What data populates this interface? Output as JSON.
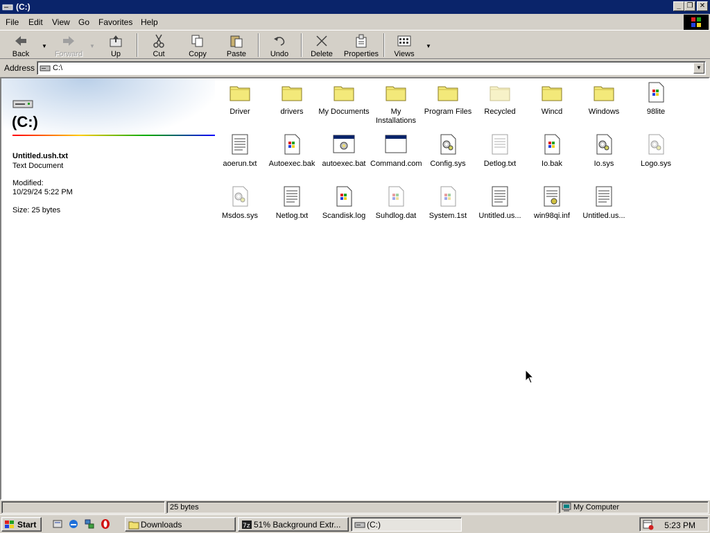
{
  "window": {
    "title": "(C:)"
  },
  "menu": {
    "file": "File",
    "edit": "Edit",
    "view": "View",
    "go": "Go",
    "favorites": "Favorites",
    "help": "Help"
  },
  "toolbar": {
    "back": "Back",
    "forward": "Forward",
    "up": "Up",
    "cut": "Cut",
    "copy": "Copy",
    "paste": "Paste",
    "undo": "Undo",
    "delete": "Delete",
    "properties": "Properties",
    "views": "Views"
  },
  "address": {
    "label": "Address",
    "value": "C:\\"
  },
  "left_pane": {
    "title": "(C:)",
    "selected_name": "Untitled.ush.txt",
    "selected_type": "Text Document",
    "modified_label": "Modified:",
    "modified_date": "10/29/24 5:22 PM",
    "size": "Size: 25 bytes"
  },
  "files": [
    {
      "name": "Driver",
      "icon": "folder-icon"
    },
    {
      "name": "drivers",
      "icon": "folder-icon"
    },
    {
      "name": "My Documents",
      "icon": "folder-icon"
    },
    {
      "name": "My Installations",
      "icon": "folder-icon"
    },
    {
      "name": "Program Files",
      "icon": "folder-icon"
    },
    {
      "name": "Recycled",
      "icon": "folder-hidden-icon"
    },
    {
      "name": "Wincd",
      "icon": "folder-icon"
    },
    {
      "name": "Windows",
      "icon": "folder-icon"
    },
    {
      "name": "98lite",
      "icon": "windows-file-icon"
    },
    {
      "name": "aoerun.txt",
      "icon": "text-file-icon"
    },
    {
      "name": "Autoexec.bak",
      "icon": "windows-file-icon"
    },
    {
      "name": "autoexec.bat",
      "icon": "batch-file-icon"
    },
    {
      "name": "Command.com",
      "icon": "dos-app-icon"
    },
    {
      "name": "Config.sys",
      "icon": "system-file-icon"
    },
    {
      "name": "Detlog.txt",
      "icon": "text-file-hidden-icon"
    },
    {
      "name": "Io.bak",
      "icon": "windows-file-icon"
    },
    {
      "name": "Io.sys",
      "icon": "system-file-icon"
    },
    {
      "name": "Logo.sys",
      "icon": "system-file-hidden-icon"
    },
    {
      "name": "Msdos.sys",
      "icon": "system-file-hidden-icon"
    },
    {
      "name": "Netlog.txt",
      "icon": "text-file-icon"
    },
    {
      "name": "Scandisk.log",
      "icon": "windows-file-icon"
    },
    {
      "name": "Suhdlog.dat",
      "icon": "windows-file-hidden-icon"
    },
    {
      "name": "System.1st",
      "icon": "windows-file-hidden-icon"
    },
    {
      "name": "Untitled.us...",
      "icon": "text-file-icon"
    },
    {
      "name": "win98qi.inf",
      "icon": "setup-info-icon"
    },
    {
      "name": "Untitled.us...",
      "icon": "text-file-icon"
    }
  ],
  "status": {
    "info": "25 bytes",
    "zone": "My Computer"
  },
  "taskbar": {
    "start": "Start",
    "tasks": [
      {
        "label": "Downloads",
        "icon": "folder-icon"
      },
      {
        "label": "51% Background Extr...",
        "icon": "7zip-icon"
      },
      {
        "label": "(C:)",
        "icon": "drive-icon"
      }
    ],
    "clock": "5:23 PM"
  }
}
